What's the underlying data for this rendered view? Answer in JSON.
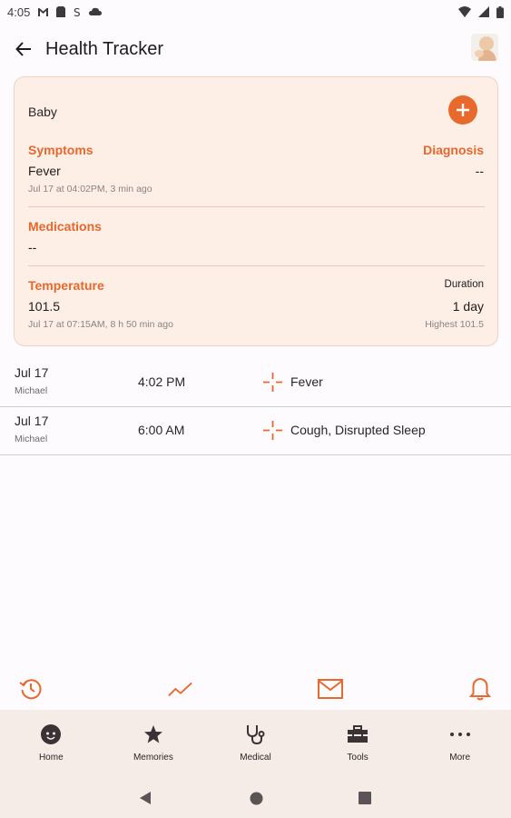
{
  "status_bar": {
    "time": "4:05"
  },
  "app_bar": {
    "title": "Health Tracker"
  },
  "card": {
    "name": "Baby",
    "symptoms_label": "Symptoms",
    "symptoms_value": "Fever",
    "symptoms_time": "Jul 17 at 04:02PM, 3 min ago",
    "diagnosis_label": "Diagnosis",
    "diagnosis_value": "--",
    "medications_label": "Medications",
    "medications_value": "--",
    "temperature_label": "Temperature",
    "temperature_value": "101.5",
    "temperature_time": "Jul 17 at 07:15AM, 8 h 50 min ago",
    "duration_label": "Duration",
    "duration_value": "1 day",
    "highest": "Highest 101.5"
  },
  "entries": [
    {
      "date": "Jul 17",
      "user": "Michael",
      "time": "4:02 PM",
      "text": "Fever"
    },
    {
      "date": "Jul 17",
      "user": "Michael",
      "time": "6:00 AM",
      "text": "Cough, Disrupted Sleep"
    }
  ],
  "bottom_nav": [
    {
      "label": "Home",
      "icon": "baby-face-icon"
    },
    {
      "label": "Memories",
      "icon": "star-icon"
    },
    {
      "label": "Medical",
      "icon": "stethoscope-icon"
    },
    {
      "label": "Tools",
      "icon": "toolbox-icon"
    },
    {
      "label": "More",
      "icon": "more-horizontal-icon"
    }
  ],
  "colors": {
    "accent": "#e8692c",
    "card_bg": "#fdeee6",
    "nav_bg": "#f5ece7"
  }
}
